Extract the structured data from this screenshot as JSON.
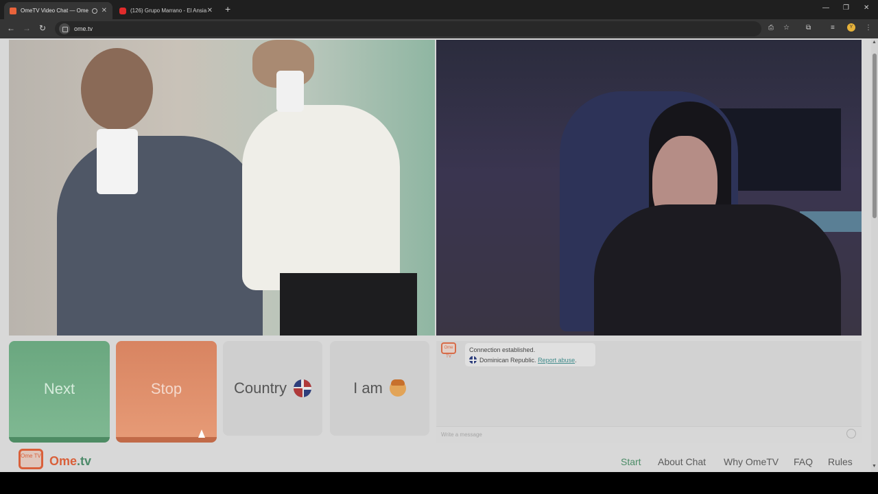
{
  "browser": {
    "tabs": [
      {
        "title": "OmeTV Video Chat — Ome",
        "active": true
      },
      {
        "title": "(126) Grupo Marrano - El Ansia",
        "active": false
      }
    ],
    "url": "ome.tv",
    "profile_initial": "Y"
  },
  "controls": {
    "next_label": "Next",
    "stop_label": "Stop",
    "country_label": "Country",
    "iam_label": "I am"
  },
  "chat": {
    "logo_text": "Ome TV",
    "status": "Connection established.",
    "country": "Dominican Republic.",
    "report_label": "Report abuse",
    "placeholder": "Write a message"
  },
  "footer": {
    "logo_text": "Ome TV",
    "brand_main": "Ome",
    "brand_suffix": ".tv",
    "nav": [
      "Start",
      "About Chat",
      "Why OmeTV",
      "FAQ",
      "Rules"
    ]
  },
  "colors": {
    "next": "#6aa77f",
    "stop": "#d88461",
    "brand": "#d9603a",
    "link": "#3f8a8a"
  }
}
